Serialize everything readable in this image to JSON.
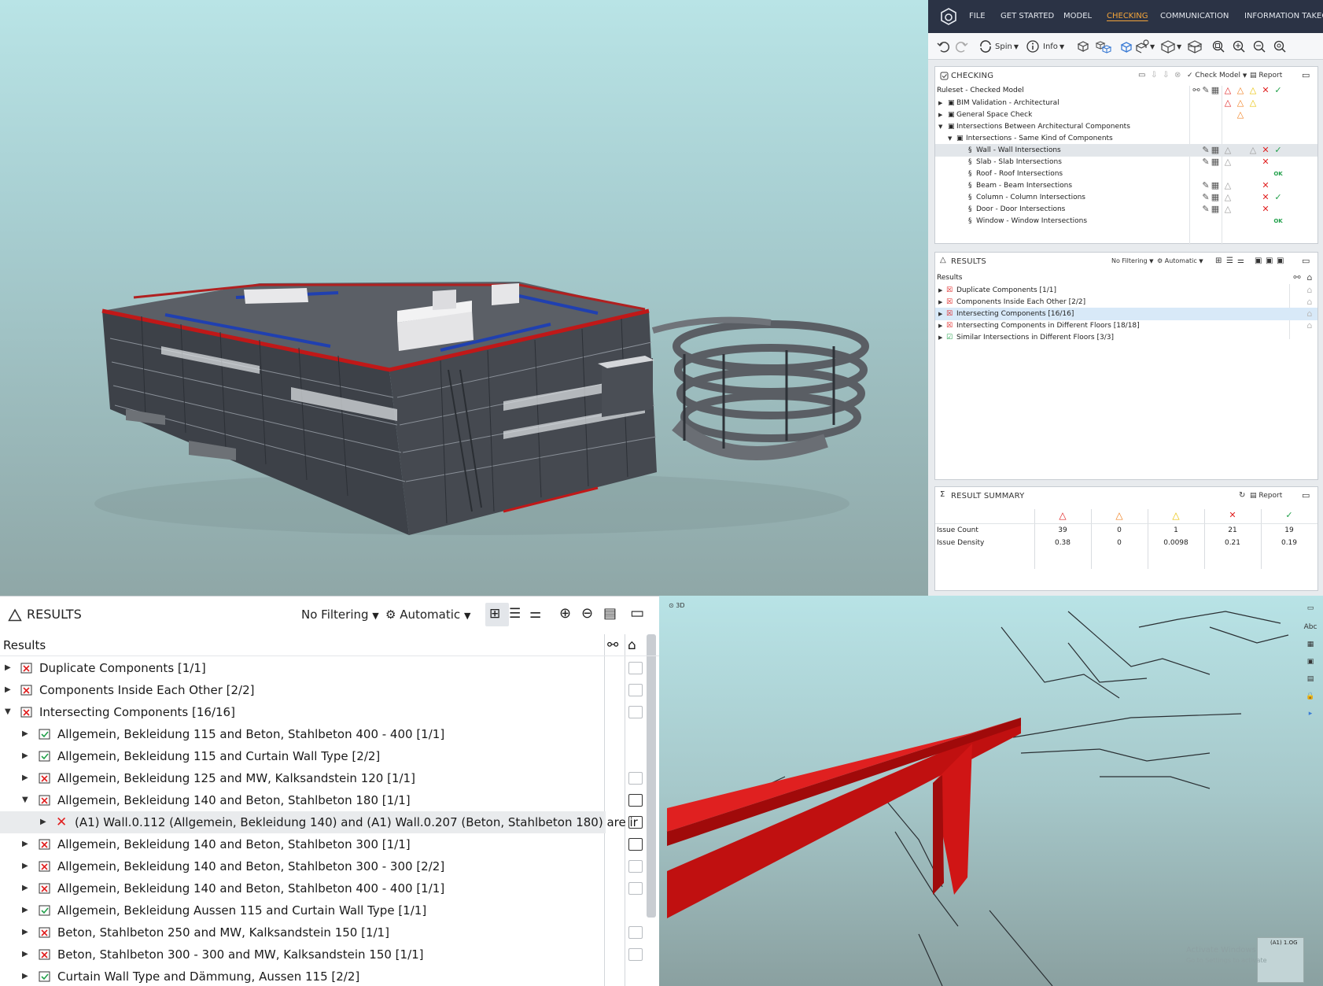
{
  "menubar": {
    "items": [
      "FILE",
      "GET STARTED",
      "MODEL",
      "CHECKING",
      "COMMUNICATION",
      "INFORMATION TAKEO"
    ],
    "active": "CHECKING"
  },
  "toolbar": {
    "spin_label": "Spin",
    "info_label": "Info"
  },
  "checking": {
    "title": "CHECKING",
    "check_model_label": "Check Model",
    "report_label": "Report",
    "ruleset_label": "Ruleset - Checked Model",
    "rows": [
      {
        "label": "BIM Validation - Architectural"
      },
      {
        "label": "General Space Check"
      },
      {
        "label": "Intersections Between Architectural Components"
      },
      {
        "label": "Intersections - Same Kind of Components"
      },
      {
        "label": "Wall - Wall Intersections"
      },
      {
        "label": "Slab - Slab Intersections"
      },
      {
        "label": "Roof - Roof Intersections"
      },
      {
        "label": "Beam - Beam Intersections"
      },
      {
        "label": "Column - Column Intersections"
      },
      {
        "label": "Door - Door Intersections"
      },
      {
        "label": "Window - Window Intersections"
      }
    ],
    "ok_text": "OK"
  },
  "results_small": {
    "title": "RESULTS",
    "filter_label": "No Filtering",
    "mode_label": "Automatic",
    "list_header": "Results",
    "rows": [
      {
        "label": "Duplicate Components [1/1]"
      },
      {
        "label": "Components Inside Each Other [2/2]"
      },
      {
        "label": "Intersecting Components [16/16]"
      },
      {
        "label": "Intersecting Components in Different Floors [18/18]"
      },
      {
        "label": "Similar Intersections in Different Floors [3/3]"
      }
    ]
  },
  "summary": {
    "title": "RESULT SUMMARY",
    "report_label": "Report",
    "issue_count_label": "Issue Count",
    "issue_density_label": "Issue Density",
    "issue_count": [
      "39",
      "0",
      "1",
      "21",
      "19"
    ],
    "issue_density": [
      "0.38",
      "0",
      "0.0098",
      "0.21",
      "0.19"
    ]
  },
  "results_big": {
    "title": "RESULTS",
    "filter_label": "No Filtering",
    "mode_label": "Automatic",
    "list_header": "Results",
    "rows": [
      {
        "label": "Duplicate Components [1/1]"
      },
      {
        "label": "Components Inside Each Other [2/2]"
      },
      {
        "label": "Intersecting Components [16/16]"
      },
      {
        "label": "Allgemein, Bekleidung 115 and Beton, Stahlbeton 400 - 400 [1/1]"
      },
      {
        "label": "Allgemein, Bekleidung 115 and Curtain Wall Type [2/2]"
      },
      {
        "label": "Allgemein, Bekleidung 125 and MW, Kalksandstein 120 [1/1]"
      },
      {
        "label": "Allgemein, Bekleidung 140 and Beton, Stahlbeton 180 [1/1]"
      },
      {
        "label": "(A1) Wall.0.112 (Allgemein, Bekleidung 140) and (A1) Wall.0.207 (Beton, Stahlbeton 180) are ir"
      },
      {
        "label": "Allgemein, Bekleidung 140 and Beton, Stahlbeton 300 [1/1]"
      },
      {
        "label": "Allgemein, Bekleidung 140 and Beton, Stahlbeton 300 - 300 [2/2]"
      },
      {
        "label": "Allgemein, Bekleidung 140 and Beton, Stahlbeton 400 - 400 [1/1]"
      },
      {
        "label": "Allgemein, Bekleidung Aussen 115 and Curtain Wall Type [1/1]"
      },
      {
        "label": "Beton, Stahlbeton 250 and MW, Kalksandstein 150 [1/1]"
      },
      {
        "label": "Beton, Stahlbeton 300 - 300 and MW, Kalksandstein 150 [1/1]"
      },
      {
        "label": "Curtain Wall Type and Dämmung, Aussen 115 [2/2]"
      }
    ]
  },
  "clash_view": {
    "view_label": "3D",
    "abc_label": "Abc",
    "floor_label": "(A1) 1.OG",
    "watermark_1": "Activate Windows",
    "watermark_2": "Go to Settings to activate"
  },
  "colors": {
    "accent": "#f2a43a",
    "menubar": "#2b3345",
    "error": "#e02020",
    "ok": "#21a04a",
    "clash": "#d01010"
  }
}
